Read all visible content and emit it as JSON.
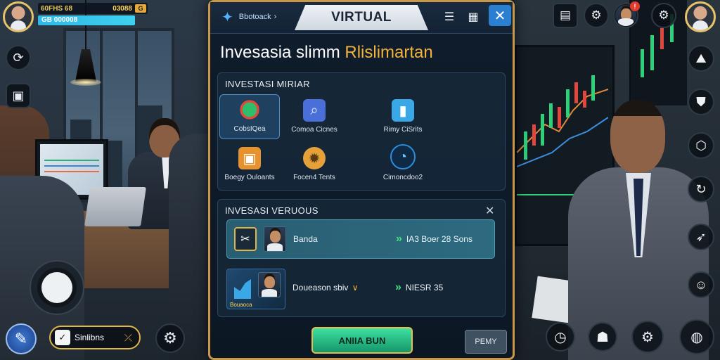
{
  "hud": {
    "money": "60FHS 68",
    "money_right": "03088",
    "money_badge": "G",
    "xp_text": "GB 000008"
  },
  "dialog": {
    "tab_label": "Bbotoack",
    "title": "VIRTUAL",
    "heading_main": "Invesasia slimm",
    "heading_accent": "Rlislimartan",
    "panel1": {
      "title": "INVESTASI MIRIAR",
      "options": [
        {
          "label": "CobsIQea",
          "icon": "pie-chart-icon",
          "color": "#2fbf6a"
        },
        {
          "label": "Comoa Cicnes",
          "icon": "magnifier-icon",
          "color": "#4b6fd8"
        },
        {
          "label": "Rimy CiSrits",
          "icon": "bar-chart-icon",
          "color": "#3aa8e6"
        },
        {
          "label": "Boegy Ouloants",
          "icon": "box-icon",
          "color": "#e8922e"
        },
        {
          "label": "Focen4 Tents",
          "icon": "gear-badge-icon",
          "color": "#e6a03a"
        },
        {
          "label": "Cimoncdoo2",
          "icon": "gauge-icon",
          "color": "#2a8fe0"
        }
      ]
    },
    "panel2": {
      "title": "INVESASI VERUOUS",
      "rows": [
        {
          "name": "Banda",
          "value": "IA3 Boer 28 Sons"
        },
        {
          "name": "Doueason sbiv",
          "value": "NIESR 35",
          "badge": "Bouaoca"
        }
      ]
    },
    "primary_button": "ANIIA BUN",
    "secondary_button": "PEMY"
  },
  "skill": {
    "label": "Sinlibns"
  },
  "colors": {
    "accent": "#f3b33a",
    "frame": "#c9974a",
    "primary": "#14966a"
  }
}
